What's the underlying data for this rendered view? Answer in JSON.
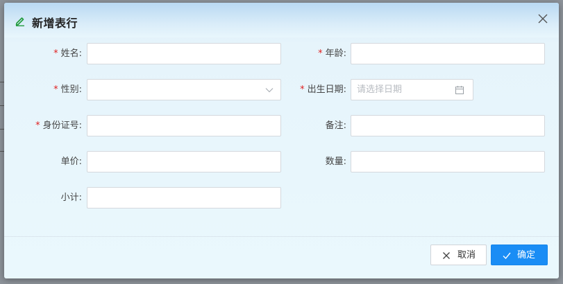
{
  "dialog": {
    "title": "新增表行",
    "cancel_label": "取消",
    "ok_label": "确定",
    "accent_color": "#1a8df5",
    "required_color": "#e02020"
  },
  "form": {
    "name_label": "姓名:",
    "age_label": "年龄:",
    "gender_label": "性别:",
    "birthdate_label": "出生日期:",
    "birthdate_placeholder": "请选择日期",
    "idcard_label": "身份证号:",
    "remark_label": "备注:",
    "unit_price_label": "单价:",
    "quantity_label": "数量:",
    "subtotal_label": "小计:",
    "required_mark": "*"
  }
}
